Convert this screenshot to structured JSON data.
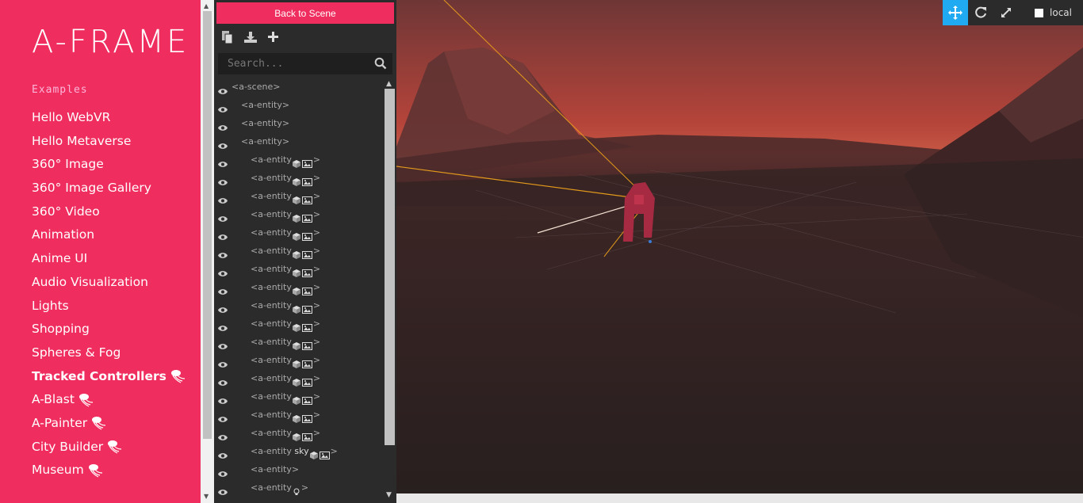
{
  "sidebar": {
    "logo": "A-FRAME",
    "section_label": "Examples",
    "items": [
      {
        "label": "Hello WebVR",
        "featured": false
      },
      {
        "label": "Hello Metaverse",
        "featured": false
      },
      {
        "label": "360° Image",
        "featured": false
      },
      {
        "label": "360° Image Gallery",
        "featured": false
      },
      {
        "label": "360° Video",
        "featured": false
      },
      {
        "label": "Animation",
        "featured": false
      },
      {
        "label": "Anime UI",
        "featured": false
      },
      {
        "label": "Audio Visualization",
        "featured": false
      },
      {
        "label": "Lights",
        "featured": false
      },
      {
        "label": "Shopping",
        "featured": false
      },
      {
        "label": "Spheres & Fog",
        "featured": false
      },
      {
        "label": "Tracked Controllers",
        "featured": true,
        "active": true
      },
      {
        "label": "A-Blast",
        "featured": true
      },
      {
        "label": "A-Painter",
        "featured": true
      },
      {
        "label": "City Builder",
        "featured": true
      },
      {
        "label": "Museum",
        "featured": true
      }
    ]
  },
  "inspector": {
    "back_label": "Back to Scene",
    "search_placeholder": "Search...",
    "tree": [
      {
        "text": "<a-scene>",
        "depth": 0,
        "icons": []
      },
      {
        "text": "<a-entity>",
        "depth": 1,
        "icons": []
      },
      {
        "text": "<a-entity>",
        "depth": 1,
        "icons": []
      },
      {
        "text": "<a-entity>",
        "depth": 1,
        "icons": []
      },
      {
        "text": "<a-entity",
        "depth": 2,
        "icons": [
          "cube",
          "image"
        ],
        "close": ">"
      },
      {
        "text": "<a-entity",
        "depth": 2,
        "icons": [
          "cube",
          "image"
        ],
        "close": ">"
      },
      {
        "text": "<a-entity",
        "depth": 2,
        "icons": [
          "cube",
          "image"
        ],
        "close": ">"
      },
      {
        "text": "<a-entity",
        "depth": 2,
        "icons": [
          "cube",
          "image"
        ],
        "close": ">"
      },
      {
        "text": "<a-entity",
        "depth": 2,
        "icons": [
          "cube",
          "image"
        ],
        "close": ">"
      },
      {
        "text": "<a-entity",
        "depth": 2,
        "icons": [
          "cube",
          "image"
        ],
        "close": ">"
      },
      {
        "text": "<a-entity",
        "depth": 2,
        "icons": [
          "cube",
          "image"
        ],
        "close": ">"
      },
      {
        "text": "<a-entity",
        "depth": 2,
        "icons": [
          "cube",
          "image"
        ],
        "close": ">"
      },
      {
        "text": "<a-entity",
        "depth": 2,
        "icons": [
          "cube",
          "image"
        ],
        "close": ">"
      },
      {
        "text": "<a-entity",
        "depth": 2,
        "icons": [
          "cube",
          "image"
        ],
        "close": ">"
      },
      {
        "text": "<a-entity",
        "depth": 2,
        "icons": [
          "cube",
          "image"
        ],
        "close": ">"
      },
      {
        "text": "<a-entity",
        "depth": 2,
        "icons": [
          "cube",
          "image"
        ],
        "close": ">"
      },
      {
        "text": "<a-entity",
        "depth": 2,
        "icons": [
          "cube",
          "image"
        ],
        "close": ">"
      },
      {
        "text": "<a-entity",
        "depth": 2,
        "icons": [
          "cube",
          "image"
        ],
        "close": ">"
      },
      {
        "text": "<a-entity",
        "depth": 2,
        "icons": [
          "cube",
          "image"
        ],
        "close": ">"
      },
      {
        "text": "<a-entity",
        "depth": 2,
        "icons": [
          "cube",
          "image"
        ],
        "close": ">"
      },
      {
        "text": "<a-entity",
        "depth": 2,
        "name": "sky",
        "icons": [
          "cube",
          "image"
        ],
        "close": ">"
      },
      {
        "text": "<a-entity>",
        "depth": 2,
        "icons": []
      },
      {
        "text": "<a-entity",
        "depth": 2,
        "icons": [
          "bulb"
        ],
        "close": ">"
      }
    ]
  },
  "viewport_toolbar": {
    "local_label": "local",
    "active_color": "#1faaf1"
  },
  "colors": {
    "brand": "#ef2d5e",
    "panel": "#2b2b2b"
  }
}
